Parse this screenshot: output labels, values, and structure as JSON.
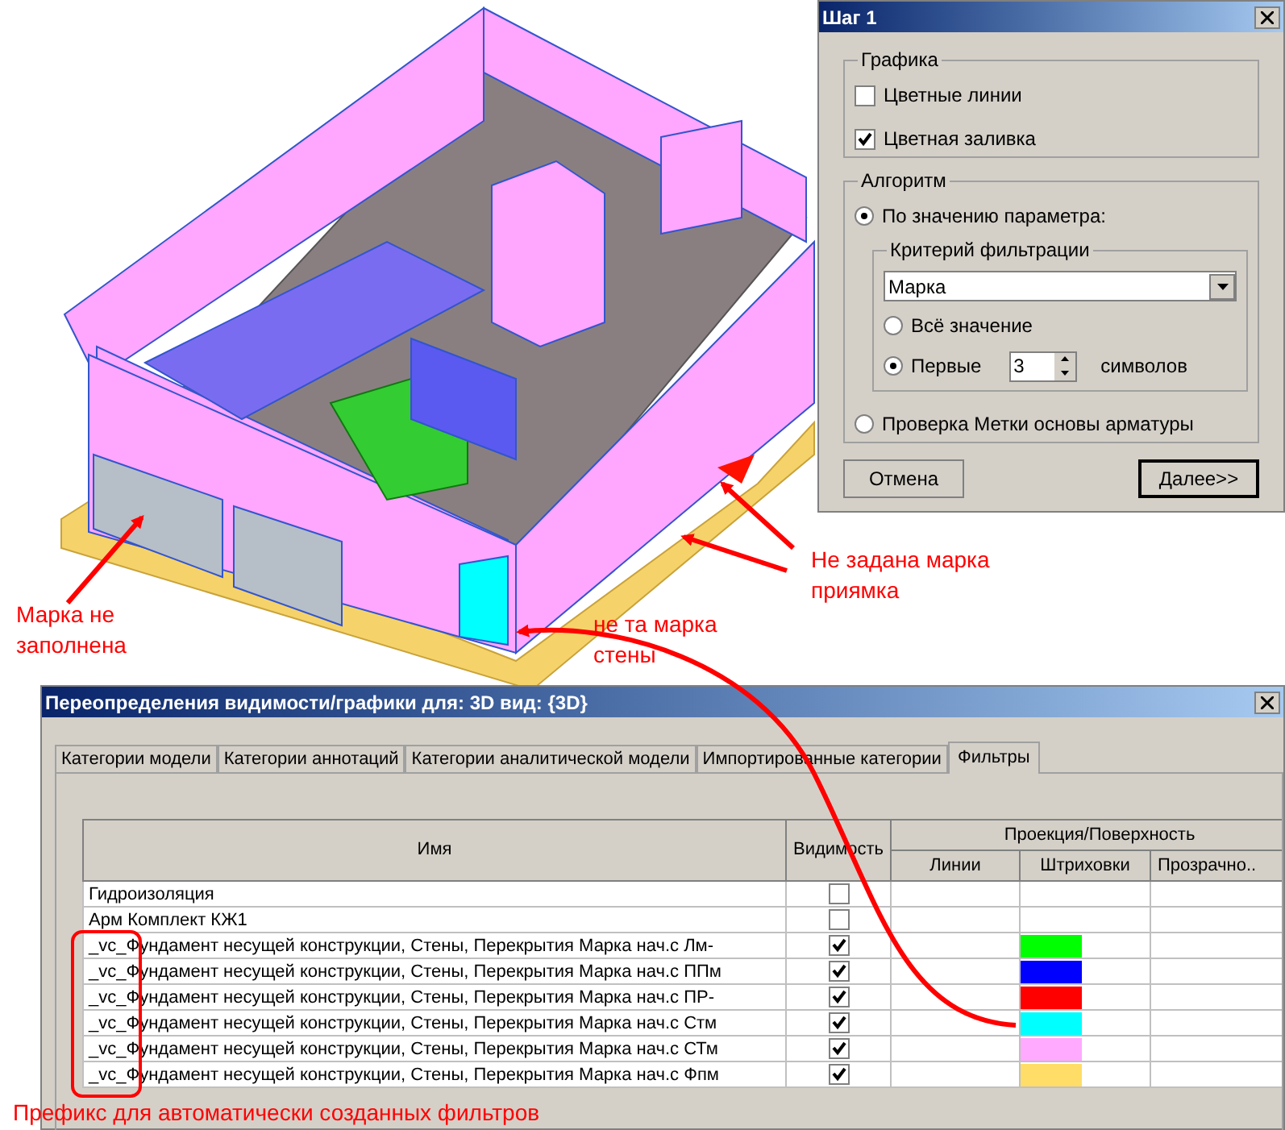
{
  "model_view": {
    "annotations": [
      {
        "kind": "left",
        "text": "Марка не заполнена"
      },
      {
        "kind": "right",
        "text": "Не задана марка приямка"
      },
      {
        "kind": "middle",
        "text": "не та марка стены"
      },
      {
        "kind": "bottom",
        "text": "Префикс для автоматически созданных фильтров"
      }
    ]
  },
  "step_dialog": {
    "title": "Шаг 1",
    "graphics": {
      "label": "Графика",
      "checkboxes": [
        {
          "label": "Цветные линии",
          "checked": false
        },
        {
          "label": "Цветная заливка",
          "checked": true
        }
      ]
    },
    "algorithm": {
      "label": "Алгоритм",
      "by_parameter": {
        "label": "По значению параметра:",
        "selected": true
      },
      "criterion": {
        "label": "Критерий фильтрации",
        "dropdown_value": "Марка",
        "options": [
          {
            "kind": "plain",
            "label": "Всё значение",
            "selected": false
          },
          {
            "kind": "spin",
            "label": "Первые",
            "selected": true,
            "spin_value": "3",
            "suffix": "символов"
          }
        ]
      },
      "rebar_check": {
        "label": "Проверка Метки основы арматуры",
        "selected": false
      }
    },
    "buttons": [
      {
        "label": "Отмена",
        "default": false
      },
      {
        "label": "Далее>>",
        "default": true
      }
    ]
  },
  "overrides_window": {
    "title": "Переопределения видимости/графики для: 3D вид: {3D}",
    "tabs": [
      {
        "label": "Категории модели",
        "selected": false
      },
      {
        "label": "Категории аннотаций",
        "selected": false
      },
      {
        "label": "Категории аналитической модели",
        "selected": false
      },
      {
        "label": "Импортированные категории",
        "selected": false
      },
      {
        "label": "Фильтры",
        "selected": true
      }
    ],
    "table": {
      "columns": {
        "name": "Имя",
        "visibility": "Видимость",
        "group": "Проекция/Поверхность",
        "lines": "Линии",
        "hatching": "Штриховки",
        "transparency": "Прозрачно.."
      },
      "rows": [
        {
          "name": "Гидроизоляция",
          "visible": false
        },
        {
          "name": "Арм Комплект КЖ1",
          "visible": false
        },
        {
          "name": "_vc_Фундамент несущей конструкции, Стены, Перекрытия Марка нач.с Лм-",
          "visible": true,
          "color": "#00ff00"
        },
        {
          "name": "_vc_Фундамент несущей конструкции, Стены, Перекрытия Марка нач.с ППм",
          "visible": true,
          "color": "#0000ff"
        },
        {
          "name": "_vc_Фундамент несущей конструкции, Стены, Перекрытия Марка нач.с ПР-",
          "visible": true,
          "color": "#ff0000"
        },
        {
          "name": "_vc_Фундамент несущей конструкции, Стены, Перекрытия Марка нач.с Стм",
          "visible": true,
          "color": "#00ffff"
        },
        {
          "name": "_vc_Фундамент несущей конструкции, Стены, Перекрытия Марка нач.с СТм",
          "visible": true,
          "color": "#ffaaff"
        },
        {
          "name": "_vc_Фундамент несущей конструкции, Стены, Перекрытия Марка нач.с Фпм",
          "visible": true,
          "color": "#ffdd66"
        }
      ]
    }
  }
}
